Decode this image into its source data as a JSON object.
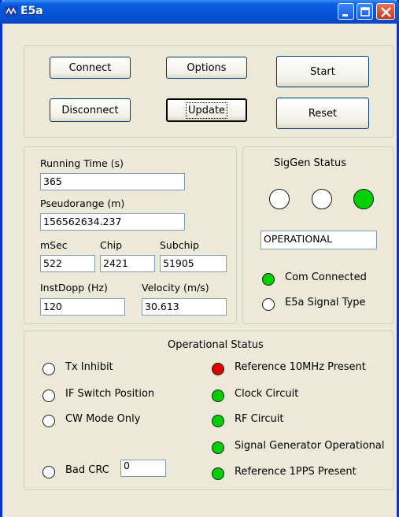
{
  "window": {
    "title": "E5a"
  },
  "buttons": {
    "connect": "Connect",
    "disconnect": "Disconnect",
    "options": "Options",
    "update": "Update",
    "start": "Start",
    "reset": "Reset"
  },
  "measurements": {
    "running_time_label": "Running Time (s)",
    "running_time_value": "365",
    "pseudorange_label": "Pseudorange (m)",
    "pseudorange_value": "156562634.237",
    "msec_label": "mSec",
    "msec_value": "522",
    "chip_label": "Chip",
    "chip_value": "2421",
    "subchip_label": "Subchip",
    "subchip_value": "51905",
    "instdopp_label": "InstDopp (Hz)",
    "instdopp_value": "120",
    "velocity_label": "Velocity (m/s)",
    "velocity_value": "30.613"
  },
  "siggen": {
    "title": "SigGen Status",
    "indicators": [
      "off",
      "off",
      "green"
    ],
    "state_value": "OPERATIONAL",
    "com_connected_label": "Com Connected",
    "com_connected_state": "green",
    "e5a_signal_label": "E5a Signal Type",
    "e5a_signal_state": "off"
  },
  "operational": {
    "title": "Operational Status",
    "tx_inhibit": "Tx Inhibit",
    "if_switch": "IF Switch Position",
    "cw_mode": "CW Mode Only",
    "bad_crc": "Bad CRC",
    "bad_crc_value": "0",
    "ref_10mhz": "Reference 10MHz Present",
    "clock_circuit": "Clock Circuit",
    "rf_circuit": "RF Circuit",
    "siggen_operational": "Signal Generator Operational",
    "ref_1pps": "Reference 1PPS Present"
  },
  "colors": {
    "led_on": "#00d000",
    "led_alarm": "#e00000",
    "titlebar": "#0654d8"
  }
}
